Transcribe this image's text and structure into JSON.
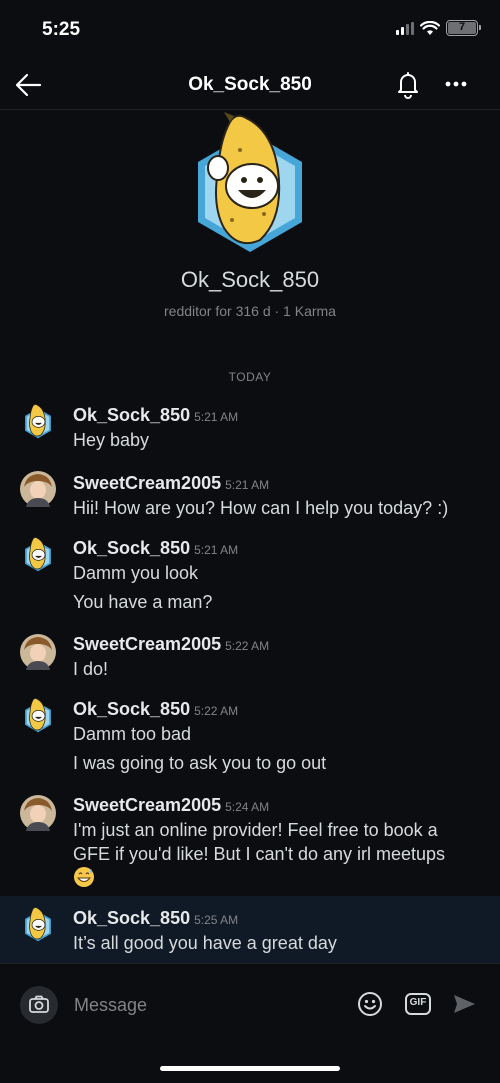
{
  "status": {
    "time": "5:25",
    "battery": "7"
  },
  "header": {
    "title": "Ok_Sock_850"
  },
  "profile": {
    "name": "Ok_Sock_850",
    "meta": "redditor for 316 d · 1 Karma"
  },
  "divider": {
    "label": "TODAY"
  },
  "messages": [
    {
      "user": "Ok_Sock_850",
      "time": "5:21 AM",
      "lines": [
        "Hey baby"
      ]
    },
    {
      "user": "SweetCream2005",
      "time": "5:21 AM",
      "lines": [
        "Hii! How are you? How can I help you today? :)"
      ]
    },
    {
      "user": "Ok_Sock_850",
      "time": "5:21 AM",
      "lines": [
        "Damm you look",
        "You have a man?"
      ]
    },
    {
      "user": "SweetCream2005",
      "time": "5:22 AM",
      "lines": [
        "I do!"
      ]
    },
    {
      "user": "Ok_Sock_850",
      "time": "5:22 AM",
      "lines": [
        "Damm too bad",
        "I was going to ask you to go out"
      ]
    },
    {
      "user": "SweetCream2005",
      "time": "5:24 AM",
      "lines": [
        "I'm just an online provider! Feel free to book a",
        "GFE if you'd like! But I can't do any irl meetups"
      ]
    },
    {
      "user": "Ok_Sock_850",
      "time": "5:25 AM",
      "lines": [
        "It’s all good you have a great day"
      ]
    }
  ],
  "composer": {
    "placeholder": "Message",
    "gif_label": "GIF"
  },
  "icons": {
    "back": "arrow-left-icon",
    "bell": "bell-icon",
    "more": "more-dots-icon",
    "camera": "camera-icon",
    "emoji": "smiley-icon",
    "send": "send-icon"
  },
  "colors": {
    "background": "#0b0d10",
    "avatar_ring": "#46a6d8",
    "highlight_row": "#0f1a26"
  }
}
